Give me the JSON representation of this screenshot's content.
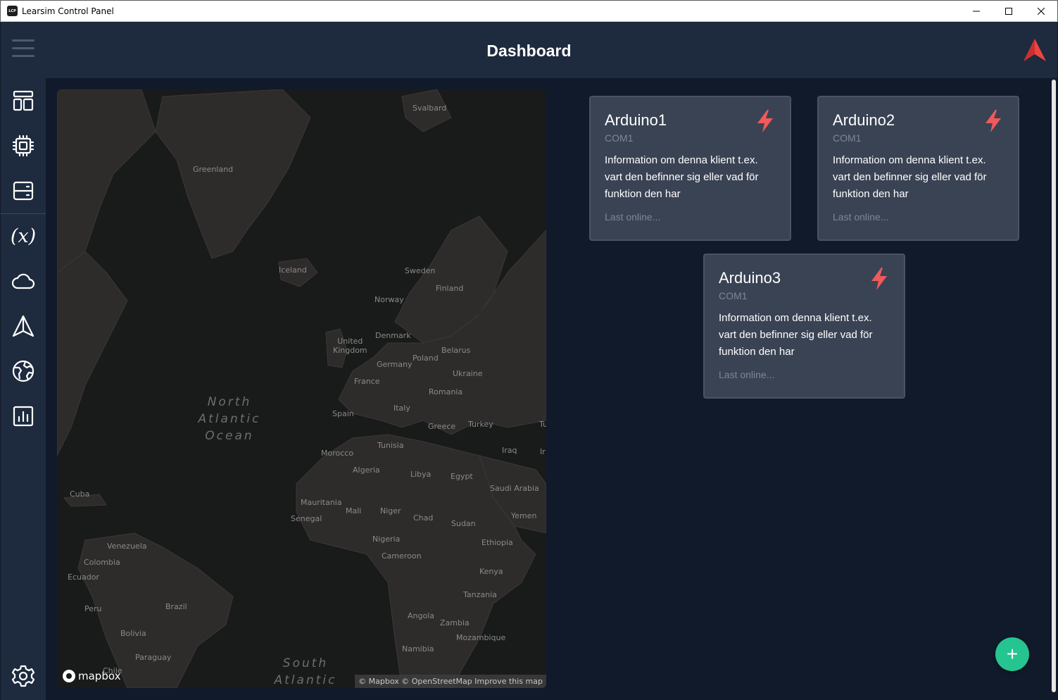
{
  "window": {
    "title": "Learsim Control Panel",
    "icon_text": "LCP",
    "controls": [
      "minimize-icon",
      "maximize-icon",
      "close-icon"
    ]
  },
  "header": {
    "title": "Dashboard",
    "logo": "learsim-logo-icon",
    "accent_color": "#ee4444"
  },
  "sidebar": {
    "items": [
      {
        "icon": "dashboard-icon"
      },
      {
        "icon": "chip-icon"
      },
      {
        "icon": "server-icon"
      },
      {
        "icon": "variable-icon",
        "glyph": "(x)"
      },
      {
        "icon": "cloud-icon"
      },
      {
        "icon": "navigation-icon"
      },
      {
        "icon": "globe-icon"
      },
      {
        "icon": "chart-icon"
      }
    ],
    "settings_icon": "gear-icon"
  },
  "map": {
    "labels": {
      "svalbard": "Svalbard",
      "greenland": "Greenland",
      "iceland": "Iceland",
      "sweden": "Sweden",
      "finland": "Finland",
      "norway": "Norway",
      "denmark": "Denmark",
      "uk": "United\nKingdom",
      "belarus": "Belarus",
      "poland": "Poland",
      "germany": "Germany",
      "ukraine": "Ukraine",
      "france": "France",
      "romania": "Romania",
      "spain": "Spain",
      "italy": "Italy",
      "greece": "Greece",
      "turkey": "Turkey",
      "iraq": "Iraq",
      "tunisia": "Tunisia",
      "morocco": "Morocco",
      "algeria": "Algeria",
      "libya": "Libya",
      "egypt": "Egypt",
      "saudi": "Saudi Arabia",
      "cuba": "Cuba",
      "mauritania": "Mauritania",
      "mali": "Mali",
      "niger": "Niger",
      "chad": "Chad",
      "sudan": "Sudan",
      "yemen": "Yemen",
      "senegal": "Senegal",
      "venezuela": "Venezuela",
      "nigeria": "Nigeria",
      "ethiopia": "Ethiopia",
      "cameroon": "Cameroon",
      "colombia": "Colombia",
      "kenya": "Kenya",
      "ecuador": "Ecuador",
      "tanzania": "Tanzania",
      "peru": "Peru",
      "brazil": "Brazil",
      "angola": "Angola",
      "zambia": "Zambia",
      "bolivia": "Bolivia",
      "mozambique": "Mozambique",
      "paraguay": "Paraguay",
      "namibia": "Namibia",
      "chile": "Chile",
      "tr_edge": "Tu",
      "ir_edge": "Ir"
    },
    "ocean_north": "North\nAtlantic\nOcean",
    "ocean_south": "South\nAtlantic",
    "logo_text": "mapbox",
    "attribution": "© Mapbox © OpenStreetMap Improve this map"
  },
  "cards": [
    {
      "name": "Arduino1",
      "port": "COM1",
      "description": "Information om denna klient t.ex. vart den befinner sig eller vad för funktion den har",
      "last_online": "Last online...",
      "status_icon": "bolt-icon"
    },
    {
      "name": "Arduino2",
      "port": "COM1",
      "description": "Information om denna klient t.ex. vart den befinner sig eller vad för funktion den har",
      "last_online": "Last online...",
      "status_icon": "bolt-icon"
    },
    {
      "name": "Arduino3",
      "port": "COM1",
      "description": "Information om denna klient t.ex. vart den befinner sig eller vad för funktion den har",
      "last_online": "Last online...",
      "status_icon": "bolt-icon"
    }
  ],
  "fab": {
    "label": "+",
    "color": "#25c490"
  }
}
